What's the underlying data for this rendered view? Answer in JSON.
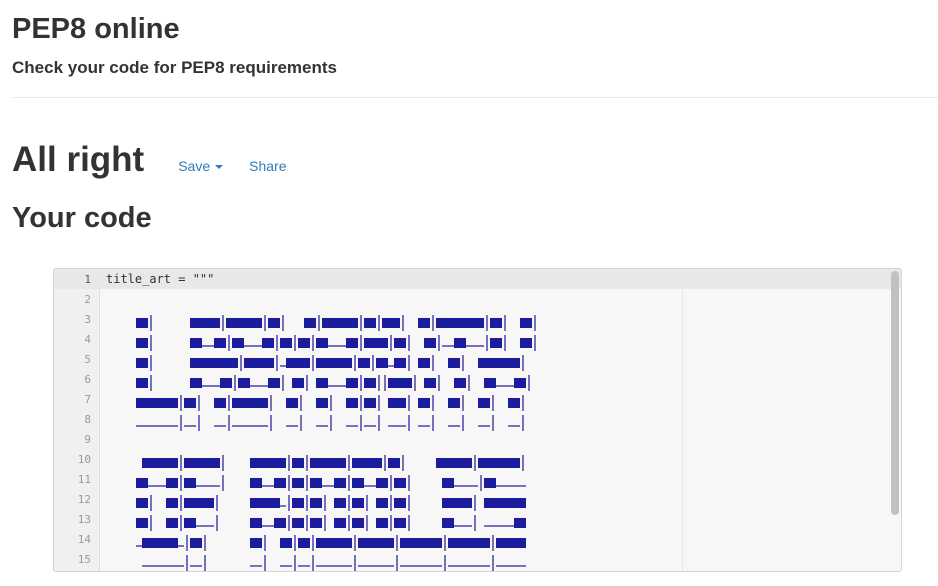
{
  "app": {
    "title": "PEP8 online",
    "subtitle": "Check your code for PEP8 requirements"
  },
  "result": {
    "title": "All right",
    "save_label": "Save",
    "share_label": "Share"
  },
  "code_section": {
    "heading": "Your code"
  },
  "editor": {
    "lines": [
      {
        "num": "1",
        "text": "title_art = \"\"\""
      },
      {
        "num": "2",
        "text": ""
      },
      {
        "num": "3",
        "text": ""
      },
      {
        "num": "4",
        "text": ""
      },
      {
        "num": "5",
        "text": ""
      },
      {
        "num": "6",
        "text": ""
      },
      {
        "num": "7",
        "text": ""
      },
      {
        "num": "8",
        "text": ""
      },
      {
        "num": "9",
        "text": ""
      },
      {
        "num": "10",
        "text": ""
      },
      {
        "num": "11",
        "text": ""
      },
      {
        "num": "12",
        "text": ""
      },
      {
        "num": "13",
        "text": ""
      },
      {
        "num": "14",
        "text": ""
      },
      {
        "num": "15",
        "text": ""
      }
    ],
    "art_colors": {
      "block": "#1c1c9e",
      "shadow": "#7a6fbf"
    }
  }
}
